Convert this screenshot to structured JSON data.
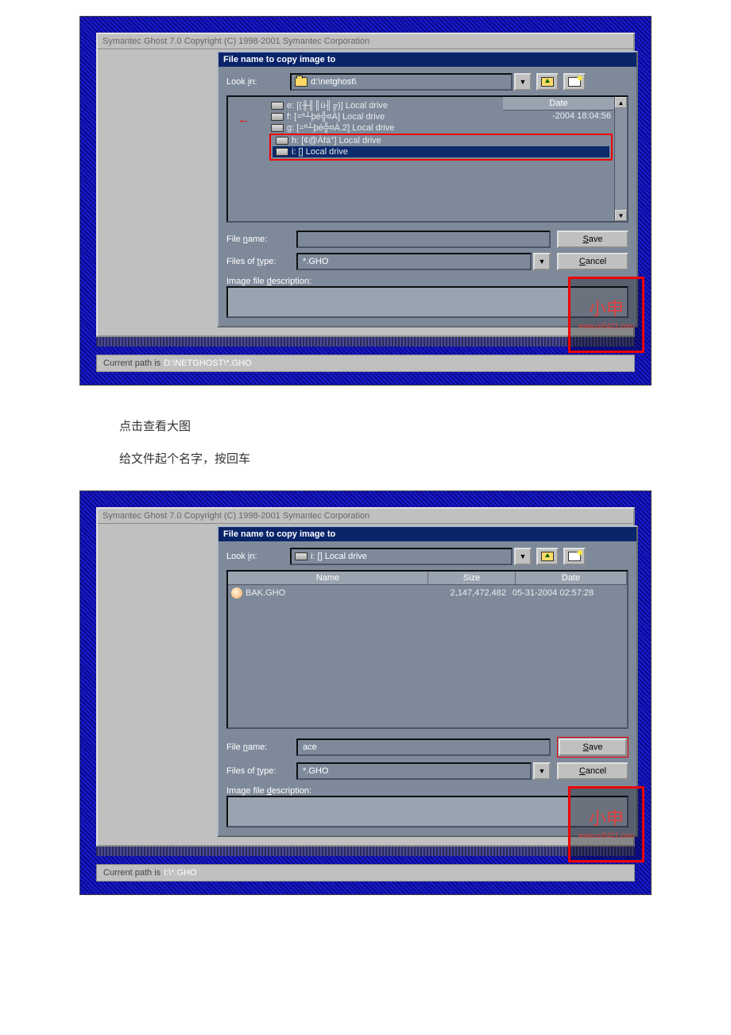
{
  "watermark": "www.bdocx.com",
  "caption_1": "点击查看大图",
  "caption_2": "给文件起个名字，按回车",
  "app_title": "Symantec Ghost 7.0    Copyright (C) 1998-2001 Symantec Corporation",
  "dialog_title": "File name to copy image to",
  "labels": {
    "look_in": "Look in:",
    "file_name": "File name:",
    "files_of_type": "Files of type:",
    "image_desc": "Image file description:"
  },
  "hotkeys": {
    "look_in": "i",
    "file_name": "n",
    "files_of_type": "t",
    "image_desc": "d",
    "save": "S",
    "cancel": "C"
  },
  "buttons": {
    "save": "Save",
    "cancel": "Cancel"
  },
  "columns": {
    "name": "Name",
    "size": "Size",
    "date": "Date"
  },
  "shot1": {
    "look_in_value": "d:\\netghost\\",
    "date_partial": "-2004 18:04:56",
    "drives": [
      "e: [(╫╢║ú╢╔)] Local drive",
      "f: [=º┴þé╬¤À] Local drive",
      "g: [=º┴þé╬¤À.2] Local drive",
      "h: [¢@Àfá°] Local drive",
      "i: [] Local drive"
    ],
    "file_name_value": "",
    "file_type_value": "*.GHO",
    "status_prefix": "Current path is",
    "status_path": "D:\\NETGHOST\\*.GHO"
  },
  "shot2": {
    "look_in_value": "i: [] Local drive",
    "files": [
      {
        "name": "BAK.GHO",
        "size": "2,147,472,482",
        "date": "05-31-2004 02:57:28"
      }
    ],
    "file_name_value": "ace",
    "file_type_value": "*.GHO",
    "status_prefix": "Current path is",
    "status_path": "I:\\*.GHO"
  },
  "stamp": {
    "chars": "小申",
    "url": "www.cn5421.com"
  }
}
